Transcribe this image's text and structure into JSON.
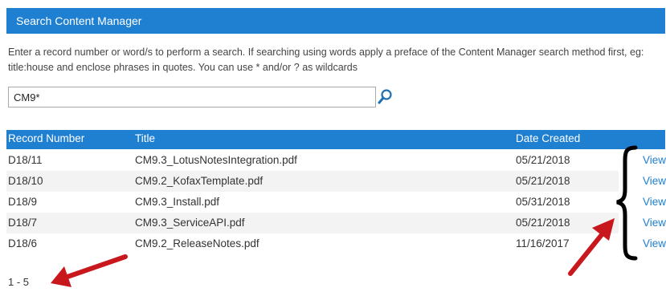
{
  "header": {
    "title": "Search Content Manager"
  },
  "instructions": "Enter a record number or word/s to perform a search. If searching using words apply a preface of the Content Manager search method first, eg: title:house and enclose phrases in quotes. You can use * and/or ? as wildcards",
  "search": {
    "value": "CM9*",
    "icon": "search-icon"
  },
  "table": {
    "columns": [
      "Record Number",
      "Title",
      "Date Created"
    ],
    "rows": [
      {
        "record_number": "D18/11",
        "title": "CM9.3_LotusNotesIntegration.pdf",
        "date_created": "05/21/2018",
        "action": "View"
      },
      {
        "record_number": "D18/10",
        "title": "CM9.2_KofaxTemplate.pdf",
        "date_created": "05/21/2018",
        "action": "View"
      },
      {
        "record_number": "D18/9",
        "title": "CM9.3_Install.pdf",
        "date_created": "05/31/2018",
        "action": "View"
      },
      {
        "record_number": "D18/7",
        "title": "CM9.3_ServiceAPI.pdf",
        "date_created": "05/21/2018",
        "action": "View"
      },
      {
        "record_number": "D18/6",
        "title": "CM9.2_ReleaseNotes.pdf",
        "date_created": "11/16/2017",
        "action": "View"
      }
    ]
  },
  "pager": {
    "range": "1 - 5"
  },
  "colors": {
    "accent": "#1f7fd0",
    "annotation_arrow": "#c8171d",
    "annotation_brace": "#000000"
  }
}
